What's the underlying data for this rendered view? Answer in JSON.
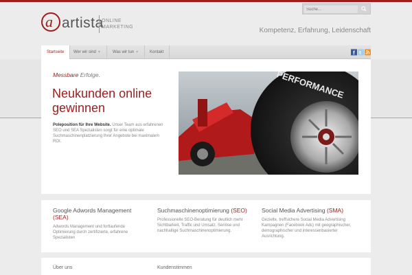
{
  "colors": {
    "accent": "#9b1d1d",
    "background": "#ececec"
  },
  "brand": {
    "name": "artista",
    "subtitle": "ONLINE MARKETING"
  },
  "search": {
    "placeholder": "Suche...",
    "icon": "search-icon"
  },
  "header": {
    "tagline": "Kompetenz, Erfahrung, Leidenschaft"
  },
  "nav": {
    "items": [
      {
        "label": "Startseite",
        "active": true
      },
      {
        "label": "Wer wir sind",
        "active": false
      },
      {
        "label": "Was wir tun",
        "active": false
      },
      {
        "label": "Kontakt",
        "active": false
      }
    ],
    "social": [
      "facebook-icon",
      "twitter-icon",
      "rss-icon"
    ]
  },
  "hero": {
    "kicker_accent": "Messbare",
    "kicker_rest": " Erfolge.",
    "title": "Neukunden online gewinnen",
    "text_bold": "Poleposition für Ihre Website.",
    "text": " Unser Team aus erfahrenen SEO und SEA Spezialisten sorgt für eine optimale Suchmaschinenplatzierung Ihrer Angebote bei maximalem ROI.",
    "image_text": "PERFORMANCE"
  },
  "features": [
    {
      "title": "Google Adwords Management ",
      "abbr": "(SEA)",
      "text": "Adwords Management und fortlaufende Optimierung durch zertifizierte, erfahrene Spezialisten"
    },
    {
      "title": "Suchmaschinenoptimierung ",
      "abbr": "(SEO)",
      "text": "Professionelle SEO-Beratung für deutlich mehr Sichtbarkeit, Traffic und Umsatz. Seriöse und nachhaltige Suchmaschinenoptimierung."
    },
    {
      "title": "Social Media Advertising ",
      "abbr": "(SMA)",
      "text": "Gezielte, treffsichere Social Media Advertising Kampagnen (Facebook Ads) mit geographischer, demographischer und interessenbasierter Ausrichtung."
    }
  ],
  "bottom": {
    "about_label": "Über uns",
    "testimonials_label": "Kundenstimmen"
  }
}
